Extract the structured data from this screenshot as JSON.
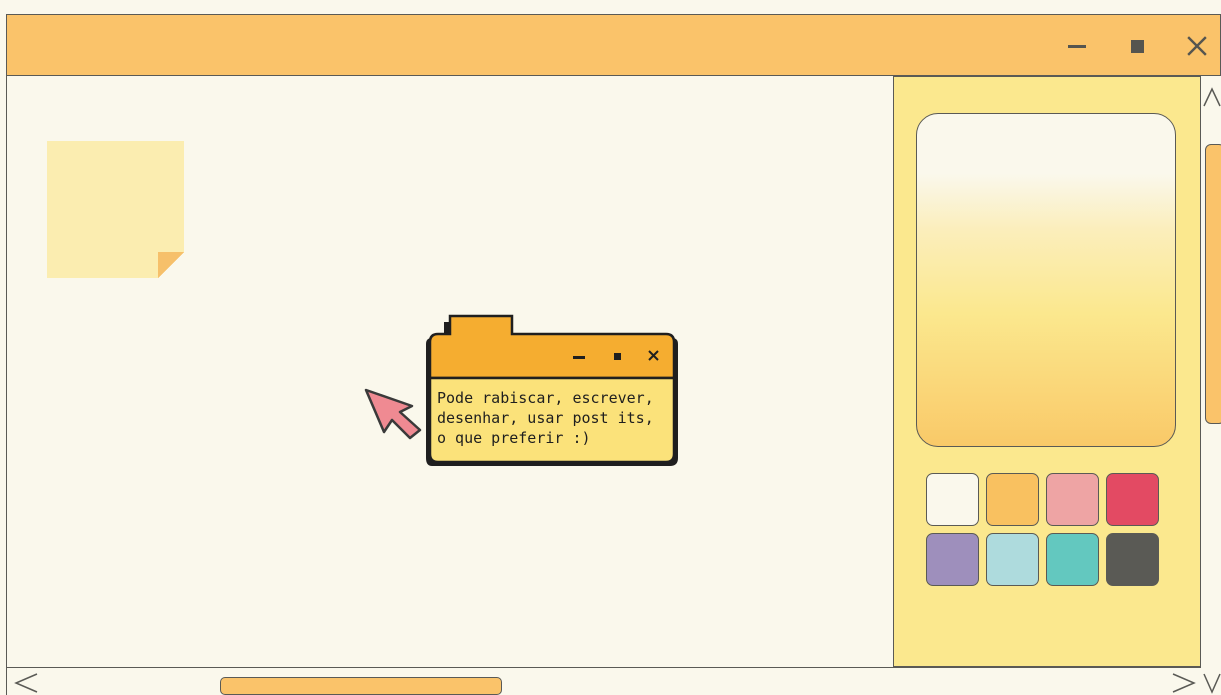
{
  "window": {
    "minimize_icon": "minimize-icon",
    "maximize_icon": "maximize-icon",
    "close_icon": "close-icon"
  },
  "tooltip": {
    "lines": [
      "Pode rabiscar, escrever,",
      "desenhar, usar post its,",
      "o que preferir :)"
    ],
    "icons": [
      "minimize-icon",
      "maximize-icon",
      "close-icon"
    ]
  },
  "panel": {
    "swatches": [
      {
        "name": "white",
        "color": "#faf8ec"
      },
      {
        "name": "orange",
        "color": "#f9c160"
      },
      {
        "name": "pink",
        "color": "#eea4a4"
      },
      {
        "name": "red",
        "color": "#e34a63"
      },
      {
        "name": "purple",
        "color": "#9e8fbc"
      },
      {
        "name": "light-blue",
        "color": "#aedbdd"
      },
      {
        "name": "teal",
        "color": "#63c8bf"
      },
      {
        "name": "dark-gray",
        "color": "#5a5a55"
      }
    ]
  },
  "colors": {
    "accent": "#fac36a",
    "background": "#faf8ec",
    "panel": "#fbe88e",
    "tooltip_header": "#f5ad30",
    "tooltip_body": "#fbe27a",
    "cursor": "#ef8a92"
  }
}
